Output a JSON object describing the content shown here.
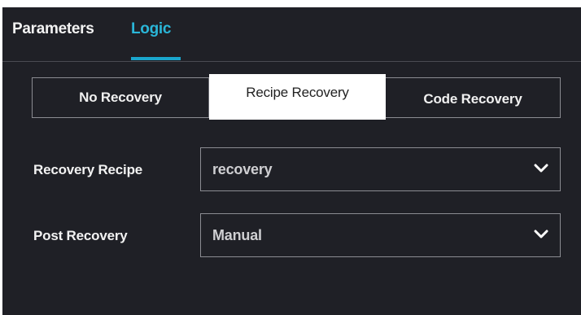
{
  "tabs": [
    {
      "label": "Parameters",
      "active": false
    },
    {
      "label": "Logic",
      "active": true
    }
  ],
  "recovery_mode": {
    "options": [
      "No Recovery",
      "Recipe Recovery",
      "Code Recovery"
    ],
    "selected": "Recipe Recovery"
  },
  "fields": {
    "recovery_recipe": {
      "label": "Recovery Recipe",
      "value": "recovery",
      "icon": "chevron-down-icon"
    },
    "post_recovery": {
      "label": "Post Recovery",
      "value": "Manual",
      "icon": "chevron-down-icon"
    }
  },
  "colors": {
    "background": "#1f2026",
    "accent": "#1aa6cd",
    "text": "#f2f2f2"
  }
}
